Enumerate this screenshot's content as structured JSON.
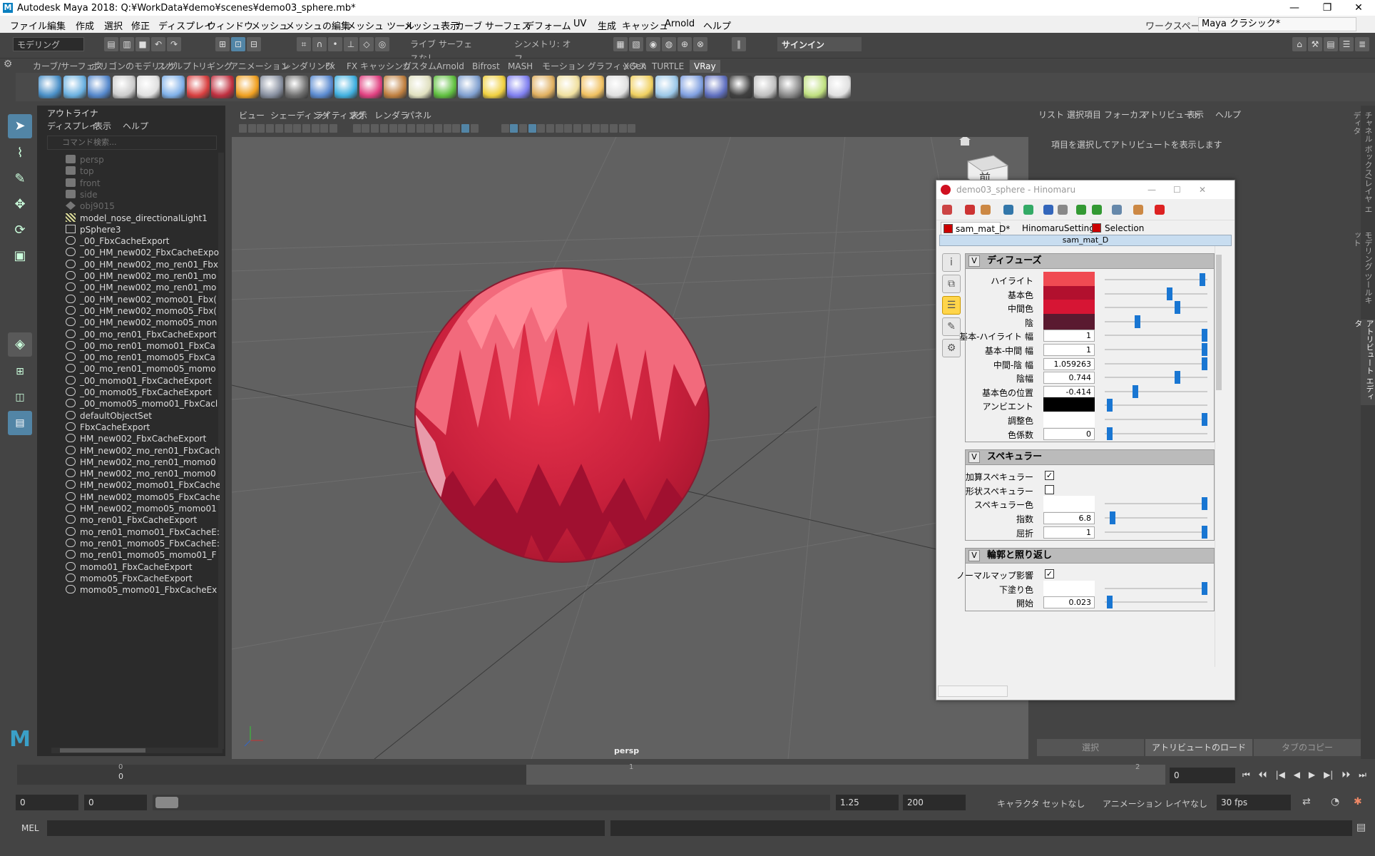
{
  "app": {
    "title": "Autodesk Maya 2018: Q:¥WorkData¥demo¥scenes¥demo03_sphere.mb*",
    "window_controls": [
      "—",
      "❐",
      "✕"
    ]
  },
  "menubar": {
    "items": [
      "ファイル",
      "編集",
      "作成",
      "選択",
      "修正",
      "ディスプレイ",
      "ウィンドウ",
      "メッシュ",
      "メッシュの編集",
      "メッシュ ツール",
      "メッシュ表示",
      "カーブ",
      "サーフェス",
      "デフォーム",
      "UV",
      "生成",
      "キャッシュ",
      "Arnold",
      "ヘルプ"
    ],
    "workspace_label": "ワークスペース:",
    "workspace_value": "Maya クラシック*"
  },
  "toolbar": {
    "mode": "モデリング",
    "live_surface": "ライブ サーフェスなし",
    "symmetry": "シンメトリ: オフ",
    "sign_in": "サインイン"
  },
  "shelf": {
    "tabs": [
      "カーブ/サーフェス",
      "ポリゴンのモデリング",
      "スカルプト",
      "リギング",
      "アニメーション",
      "レンダリング",
      "Fx",
      "FX キャッシング",
      "カスタム",
      "Arnold",
      "Bifrost",
      "MASH",
      "モーション グラフィックス",
      "XGen",
      "TURTLE",
      "VRay"
    ],
    "active_tab": "VRay"
  },
  "outliner": {
    "title": "アウトライナ",
    "menu": [
      "ディスプレイ",
      "表示",
      "ヘルプ"
    ],
    "search_placeholder": "コマンド検索...",
    "items": [
      {
        "label": "persp",
        "dim": true
      },
      {
        "label": "top",
        "dim": true
      },
      {
        "label": "front",
        "dim": true
      },
      {
        "label": "side",
        "dim": true
      },
      {
        "label": "obj9015",
        "dim": true
      },
      {
        "label": "model_nose_directionalLight1",
        "dim": false
      },
      {
        "label": "pSphere3",
        "dim": false
      },
      {
        "label": "_00_FbxCacheExport",
        "dim": false
      },
      {
        "label": "_00_HM_new002_FbxCacheExpo",
        "dim": false
      },
      {
        "label": "_00_HM_new002_mo_ren01_Fbx",
        "dim": false
      },
      {
        "label": "_00_HM_new002_mo_ren01_mo",
        "dim": false
      },
      {
        "label": "_00_HM_new002_mo_ren01_mo",
        "dim": false
      },
      {
        "label": "_00_HM_new002_momo01_Fbx(",
        "dim": false
      },
      {
        "label": "_00_HM_new002_momo05_Fbx(",
        "dim": false
      },
      {
        "label": "_00_HM_new002_momo05_mon",
        "dim": false
      },
      {
        "label": "_00_mo_ren01_FbxCacheExport",
        "dim": false
      },
      {
        "label": "_00_mo_ren01_momo01_FbxCa",
        "dim": false
      },
      {
        "label": "_00_mo_ren01_momo05_FbxCa",
        "dim": false
      },
      {
        "label": "_00_mo_ren01_momo05_momo",
        "dim": false
      },
      {
        "label": "_00_momo01_FbxCacheExport",
        "dim": false
      },
      {
        "label": "_00_momo05_FbxCacheExport",
        "dim": false
      },
      {
        "label": "_00_momo05_momo01_FbxCacl",
        "dim": false
      },
      {
        "label": "defaultObjectSet",
        "dim": false
      },
      {
        "label": "FbxCacheExport",
        "dim": false
      },
      {
        "label": "HM_new002_FbxCacheExport",
        "dim": false
      },
      {
        "label": "HM_new002_mo_ren01_FbxCach",
        "dim": false
      },
      {
        "label": "HM_new002_mo_ren01_momo0",
        "dim": false
      },
      {
        "label": "HM_new002_mo_ren01_momo0",
        "dim": false
      },
      {
        "label": "HM_new002_momo01_FbxCache",
        "dim": false
      },
      {
        "label": "HM_new002_momo05_FbxCache",
        "dim": false
      },
      {
        "label": "HM_new002_momo05_momo01",
        "dim": false
      },
      {
        "label": "mo_ren01_FbxCacheExport",
        "dim": false
      },
      {
        "label": "mo_ren01_momo01_FbxCacheE:",
        "dim": false
      },
      {
        "label": "mo_ren01_momo05_FbxCacheE:",
        "dim": false
      },
      {
        "label": "mo_ren01_momo05_momo01_F",
        "dim": false
      },
      {
        "label": "momo01_FbxCacheExport",
        "dim": false
      },
      {
        "label": "momo05_FbxCacheExport",
        "dim": false
      },
      {
        "label": "momo05_momo01_FbxCacheEx",
        "dim": false
      }
    ]
  },
  "viewport": {
    "menu": [
      "ビュー",
      "シェーディング",
      "ライティング",
      "表示",
      "レンダラ",
      "パネル"
    ],
    "camera_label": "persp",
    "viewcube_label": "前"
  },
  "attribute_editor": {
    "menu": [
      "リスト",
      "選択項目",
      "フォーカス",
      "アトリビュート",
      "表示",
      "ヘルプ"
    ],
    "hint": "項目を選択してアトリビュートを表示します",
    "bottom_buttons": [
      "選択",
      "アトリビュートのロード",
      "タブのコピー"
    ],
    "side_tabs": [
      "チャネル ボックス/レイヤ エディタ",
      "モデリング ツールキット",
      "アトリビュート エディタ"
    ]
  },
  "hinomaru": {
    "title": "demo03_sphere - Hinomaru",
    "tabs": [
      "sam_mat_D*",
      "HinomaruSetting",
      "Selection"
    ],
    "material_name": "sam_mat_D",
    "sections": {
      "diffuse": {
        "title": "ディフューズ",
        "rows": [
          {
            "label": "ハイライト",
            "kind": "color",
            "color": "#f04a52",
            "slider": 0.95
          },
          {
            "label": "基本色",
            "kind": "color",
            "color": "#b2102e",
            "slider": 0.62
          },
          {
            "label": "中間色",
            "kind": "color",
            "color": "#d61534",
            "slider": 0.7
          },
          {
            "label": "陰",
            "kind": "color",
            "color": "#5a1a30",
            "slider": 0.3
          },
          {
            "label": "基本-ハイライト 幅",
            "kind": "num",
            "value": "1",
            "slider": 0.97
          },
          {
            "label": "基本-中間 幅",
            "kind": "num",
            "value": "1",
            "slider": 0.97
          },
          {
            "label": "中間-陰 幅",
            "kind": "num",
            "value": "1.059263",
            "slider": 0.97
          },
          {
            "label": "陰幅",
            "kind": "num",
            "value": "0.744",
            "slider": 0.7
          },
          {
            "label": "基本色の位置",
            "kind": "num",
            "value": "-0.414",
            "slider": 0.28
          },
          {
            "label": "アンビエント",
            "kind": "color",
            "color": "#000000",
            "slider": 0.02
          },
          {
            "label": "調整色",
            "kind": "color",
            "color": "#ffffff",
            "slider": 0.97
          },
          {
            "label": "色係数",
            "kind": "num",
            "value": "0",
            "slider": 0.02
          }
        ]
      },
      "specular": {
        "title": "スペキュラー",
        "rows": [
          {
            "label": "加算スペキュラー",
            "kind": "check",
            "checked": true
          },
          {
            "label": "形状スペキュラー",
            "kind": "check",
            "checked": false
          },
          {
            "label": "スペキュラー色",
            "kind": "color",
            "color": "#ffffff",
            "slider": 0.97
          },
          {
            "label": "指数",
            "kind": "num",
            "value": "6.8",
            "slider": 0.05
          },
          {
            "label": "屈折",
            "kind": "num",
            "value": "1",
            "slider": 0.97
          }
        ]
      },
      "outline": {
        "title": "輪郭と照り返し",
        "rows": [
          {
            "label": "ノーマルマップ影響",
            "kind": "check",
            "checked": true
          },
          {
            "label": "下塗り色",
            "kind": "color",
            "color": "#ffffff",
            "slider": 0.97
          },
          {
            "label": "開始",
            "kind": "num",
            "value": "0.023",
            "slider": 0.02
          }
        ]
      }
    }
  },
  "timeline": {
    "ticks": [
      "0",
      "1",
      "2"
    ],
    "current_frame": "0",
    "range_start": "0",
    "playback_start": "0",
    "playback_end": "1.25",
    "range_end": "200",
    "character_set": "キャラクタ セットなし",
    "anim_layer": "アニメーション レイヤなし",
    "fps": "30 fps",
    "playback_buttons": [
      "⏮",
      "⏴⏴",
      "|◀",
      "◀",
      "▶",
      "▶|",
      "⏵⏵",
      "⏭"
    ]
  },
  "command_line": {
    "label": "MEL"
  },
  "colors": {
    "maya_bg": "#444444",
    "sphere_base": "#c8203c",
    "accent_blue": "#1976d2"
  }
}
